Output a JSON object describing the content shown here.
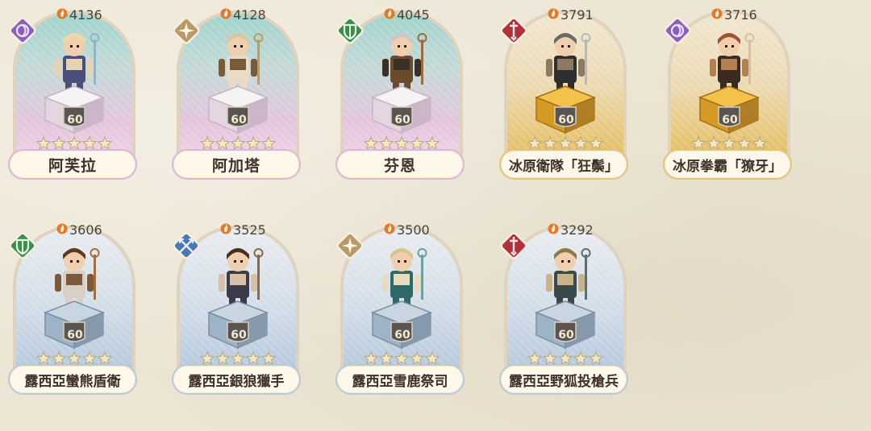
{
  "colors": {
    "violet_class": "#8a5fc0",
    "gold_class": "#b89a6a",
    "green_class": "#3a8e4a",
    "red_class": "#b2303c",
    "blue_class": "#4a77b8",
    "power_text": "#4a4136",
    "level_text": "#f3ead3"
  },
  "heroes": [
    {
      "name": "阿芙拉",
      "power": "4136",
      "level": "60",
      "stars": 5,
      "class_icon": "violet-spiral-icon",
      "rarity": "violet"
    },
    {
      "name": "阿加塔",
      "power": "4128",
      "level": "60",
      "stars": 5,
      "class_icon": "gold-compass-icon",
      "rarity": "violet"
    },
    {
      "name": "芬恩",
      "power": "4045",
      "level": "60",
      "stars": 5,
      "class_icon": "green-shield-icon",
      "rarity": "violet"
    },
    {
      "name": "冰原衛隊「狂鬃」",
      "power": "3791",
      "level": "60",
      "stars": 5,
      "class_icon": "red-sword-icon",
      "rarity": "gold"
    },
    {
      "name": "冰原拳霸「獠牙」",
      "power": "3716",
      "level": "60",
      "stars": 5,
      "class_icon": "violet-spiral-icon",
      "rarity": "gold"
    },
    {
      "name": "露西亞蠻熊盾衛",
      "power": "3606",
      "level": "60",
      "stars": 5,
      "class_icon": "green-shield-icon",
      "rarity": "blue"
    },
    {
      "name": "露西亞銀狼獵手",
      "power": "3525",
      "level": "60",
      "stars": 5,
      "class_icon": "blue-crossed-arrows-icon",
      "rarity": "blue"
    },
    {
      "name": "露西亞雪鹿祭司",
      "power": "3500",
      "level": "60",
      "stars": 5,
      "class_icon": "gold-compass-icon",
      "rarity": "blue"
    },
    {
      "name": "露西亞野狐投槍兵",
      "power": "3292",
      "level": "60",
      "stars": 5,
      "class_icon": "red-sword-icon",
      "rarity": "blue"
    }
  ]
}
